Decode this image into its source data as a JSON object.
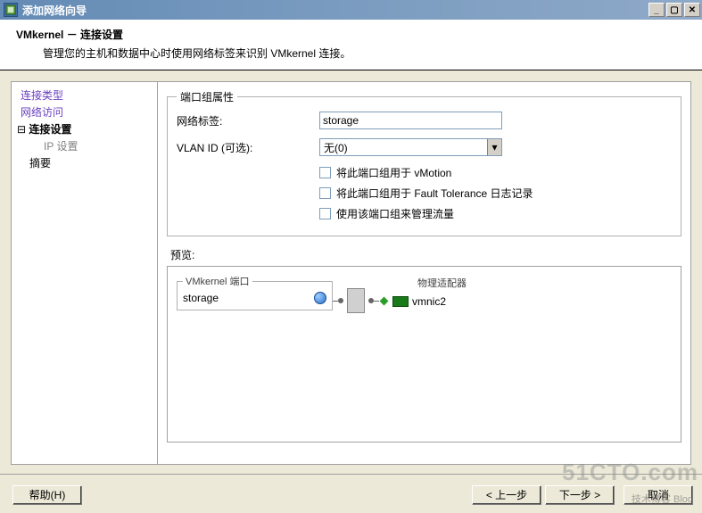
{
  "window": {
    "title": "添加网络向导"
  },
  "header": {
    "title": "VMkernel － 连接设置",
    "desc": "管理您的主机和数据中心时使用网络标签来识别 VMkernel 连接。"
  },
  "nav": {
    "step1": "连接类型",
    "step2": "网络访问",
    "step3_marker": "⊟",
    "step3": "连接设置",
    "step3_sub": "IP 设置",
    "step4": "摘要"
  },
  "portgroup": {
    "legend": "端口组属性",
    "label_netlabel": "网络标签:",
    "value_netlabel": "storage",
    "label_vlan": "VLAN ID (可选):",
    "value_vlan": "无(0)",
    "cb_vmotion": "将此端口组用于 vMotion",
    "cb_ft": "将此端口组用于 Fault Tolerance 日志记录",
    "cb_mgmt": "使用该端口组来管理流量"
  },
  "preview": {
    "label": "预览:",
    "vmkernel_legend": "VMkernel 端口",
    "port_name": "storage",
    "adapter_legend": "物理适配器",
    "nic_name": "vmnic2"
  },
  "buttons": {
    "help": "帮助(H)",
    "back": "< 上一步",
    "next": "下一步 >",
    "cancel": "取消"
  },
  "watermark": {
    "big": "51CTO.com",
    "small": "技术博客 Blog"
  }
}
